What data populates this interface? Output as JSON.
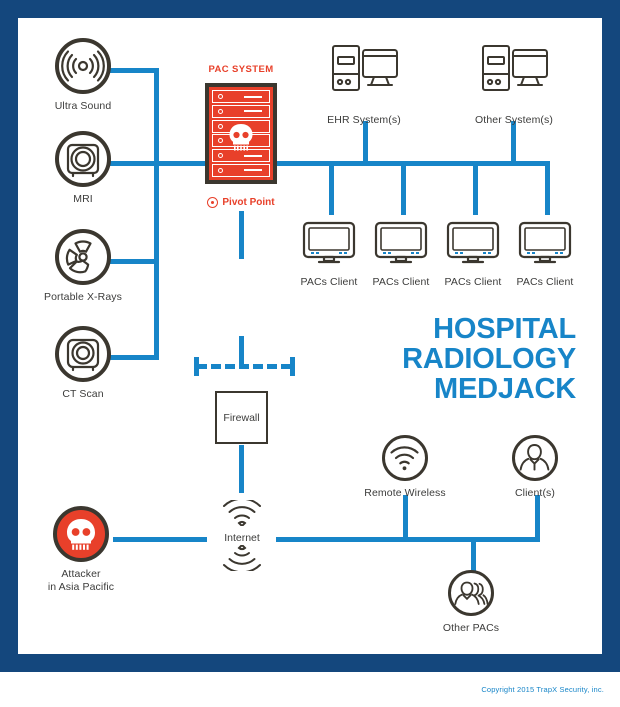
{
  "meta": {
    "colors": {
      "frame_navy": "#14477D",
      "line_blue": "#1785C8",
      "alert_red": "#E8402A",
      "icon_dark": "#3B372F",
      "label_gray": "#3c3c3b"
    }
  },
  "headline": {
    "line1": "HOSPITAL",
    "line2": "RADIOLOGY",
    "line3": "MEDJACK"
  },
  "pac_system": {
    "title": "PAC SYSTEM",
    "pivot_label": "Pivot Point",
    "bay_count": 6,
    "icon": "skull-icon"
  },
  "modalities": [
    {
      "id": "ultra-sound",
      "label": "Ultra Sound",
      "icon": "ultrasound-icon"
    },
    {
      "id": "mri",
      "label": "MRI",
      "icon": "mri-icon"
    },
    {
      "id": "portable-xrays",
      "label": "Portable X-Rays",
      "icon": "radiation-icon"
    },
    {
      "id": "ct-scan",
      "label": "CT Scan",
      "icon": "ct-scan-icon"
    }
  ],
  "systems": [
    {
      "id": "ehr-system",
      "label": "EHR System(s)",
      "icon": "desktop-tower-icon"
    },
    {
      "id": "other-system",
      "label": "Other System(s)",
      "icon": "desktop-tower-icon"
    }
  ],
  "pacs_clients": [
    {
      "id": "pacs-client-1",
      "label": "PACs Client",
      "icon": "monitor-icon"
    },
    {
      "id": "pacs-client-2",
      "label": "PACs Client",
      "icon": "monitor-icon"
    },
    {
      "id": "pacs-client-3",
      "label": "PACs Client",
      "icon": "monitor-icon"
    },
    {
      "id": "pacs-client-4",
      "label": "PACs Client",
      "icon": "monitor-icon"
    }
  ],
  "firewall": {
    "label": "Firewall"
  },
  "internet": {
    "label": "Internet",
    "icon": "wifi-icon"
  },
  "attacker": {
    "label": "Attacker\nin Asia Pacific",
    "icon": "skull-icon"
  },
  "remote_wireless": {
    "label": "Remote Wireless",
    "icon": "wifi-icon"
  },
  "clients": {
    "label": "Client(s)",
    "icon": "person-icon"
  },
  "other_pacs": {
    "label": "Other PACs",
    "icon": "people-group-icon"
  },
  "copyright": "Copyright 2015 TrapX Security, inc."
}
